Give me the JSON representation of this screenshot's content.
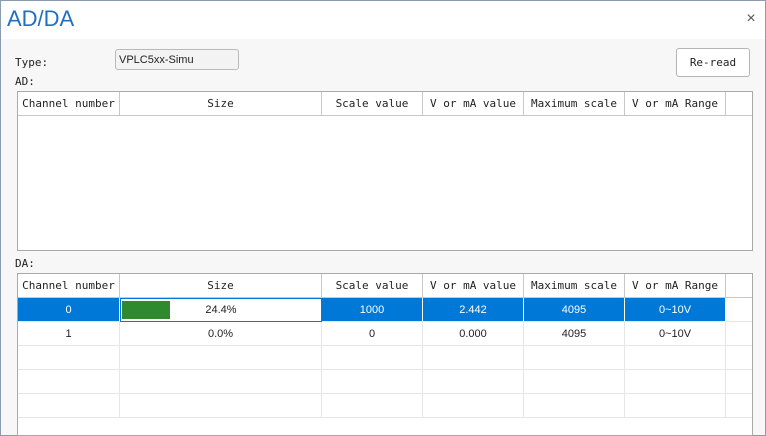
{
  "window": {
    "title": "AD/DA",
    "close_glyph": "×"
  },
  "type_label": "Type:",
  "type_value": "VPLC5xx-Simu",
  "reread_label": "Re-read",
  "ad_label": "AD:",
  "da_label": "DA:",
  "columns": [
    "Channel number",
    "Size",
    "Scale value",
    "V or mA value",
    "Maximum scale",
    "V or mA Range"
  ],
  "da_rows": [
    {
      "channel": "0",
      "size": "24.4%",
      "size_fraction": 0.244,
      "scale": "1000",
      "value": "2.442",
      "max_scale": "4095",
      "range": "0~10V",
      "selected": true
    },
    {
      "channel": "1",
      "size": "0.0%",
      "size_fraction": 0.0,
      "scale": "0",
      "value": "0.000",
      "max_scale": "4095",
      "range": "0~10V",
      "selected": false
    }
  ],
  "colors": {
    "accent": "#1f6fc5",
    "selection": "#0078d7",
    "bar": "#2f8a2f"
  }
}
